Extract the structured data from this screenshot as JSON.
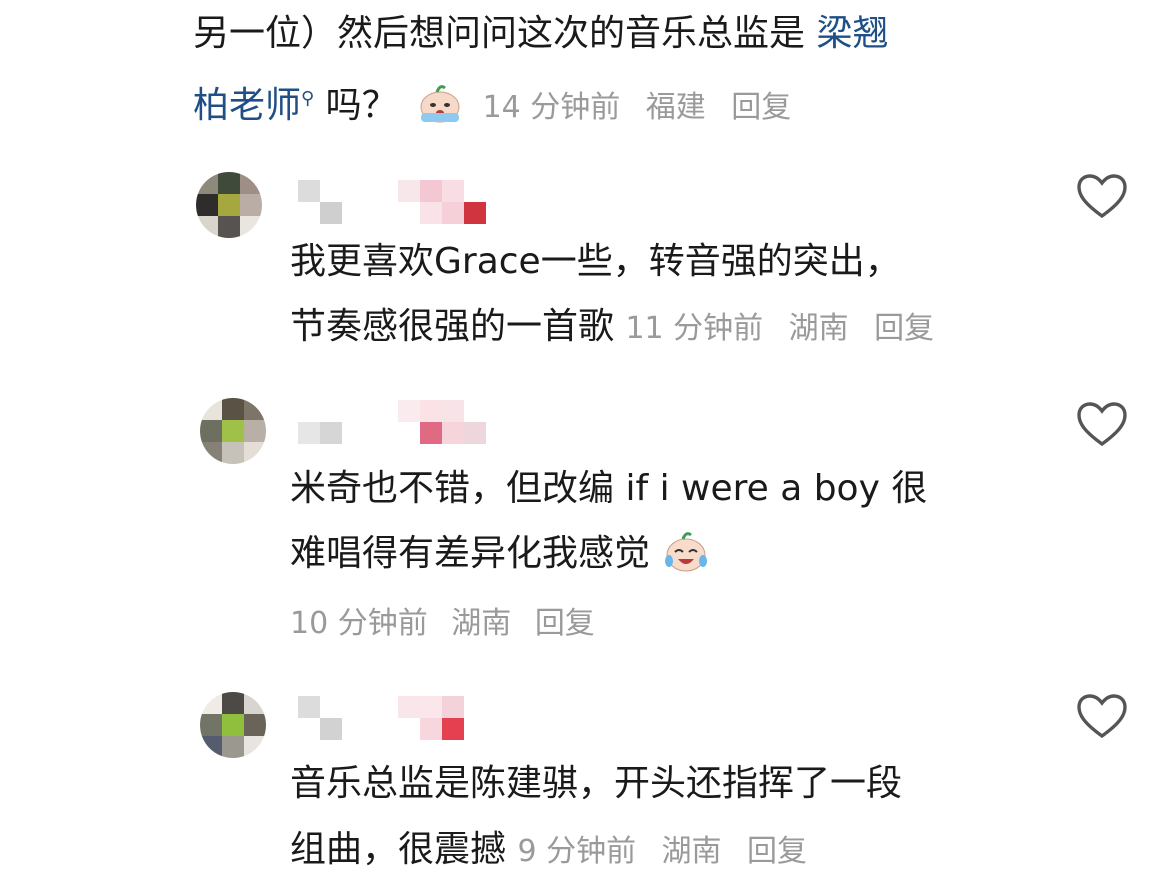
{
  "top_comment": {
    "line1_text": "另一位）然后想问问这次的音乐总监是",
    "line1_link": "梁翘",
    "line2_link": "柏老师",
    "line2_text": "吗？",
    "search_mark": "⚲",
    "emoji": "crying-face",
    "time": "14 分钟前",
    "location": "福建",
    "reply": "回复"
  },
  "comments": [
    {
      "line1": "我更喜欢Grace一些，转音强的突出，",
      "line2": "节奏感很强的一首歌",
      "time": "11 分钟前",
      "location": "湖南",
      "reply": "回复"
    },
    {
      "line1": "米奇也不错，但改编 if i were a boy 很",
      "line2": "难唱得有差异化我感觉",
      "emoji": "laughing-crying-face",
      "time": "10 分钟前",
      "location": "湖南",
      "reply": "回复"
    },
    {
      "line1": "音乐总监是陈建骐，开头还指挥了一段",
      "line2": "组曲，很震撼",
      "time": "9 分钟前",
      "location": "湖南",
      "reply": "回复"
    }
  ],
  "colors": {
    "meta": "#9a9a9a",
    "link": "#1f4f86",
    "text": "#1a1a1a"
  }
}
